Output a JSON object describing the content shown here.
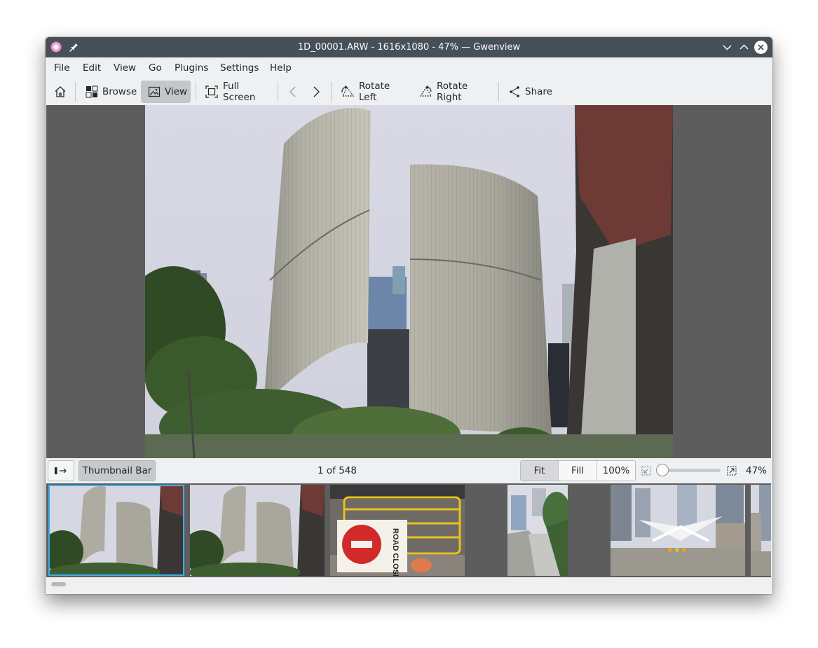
{
  "window": {
    "title": "1D_00001.ARW - 1616x1080 - 47% — Gwenview"
  },
  "menubar": {
    "items": [
      "File",
      "Edit",
      "View",
      "Go",
      "Plugins",
      "Settings",
      "Help"
    ]
  },
  "toolbar": {
    "browse_label": "Browse",
    "view_label": "View",
    "fullscreen_label": "Full Screen",
    "rotate_left_label": "Rotate Left",
    "rotate_right_label": "Rotate Right",
    "share_label": "Share",
    "active_mode": "View"
  },
  "statusbar": {
    "thumbnail_bar_label": "Thumbnail Bar",
    "counter": "1 of 548",
    "fit_label": "Fit",
    "fill_label": "Fill",
    "actual_size_label": "100%",
    "zoom_percent": "47%",
    "active_zoom_mode": "Fit",
    "zoom_slider_fraction": 0.0
  },
  "thumbnails": {
    "selected_index": 0,
    "items": [
      {
        "subject": "city-hall-towers"
      },
      {
        "subject": "city-hall-towers"
      },
      {
        "subject": "road-closed-barricade",
        "sign_text": "ROAD CLOSED"
      },
      {
        "subject": "street-sidewalk"
      },
      {
        "subject": "plaza-canopy"
      }
    ]
  },
  "colors": {
    "titlebar": "#475057",
    "accent": "#3daee9",
    "viewport_bg": "#5d5d5d",
    "window_bg": "#eff0f1"
  }
}
